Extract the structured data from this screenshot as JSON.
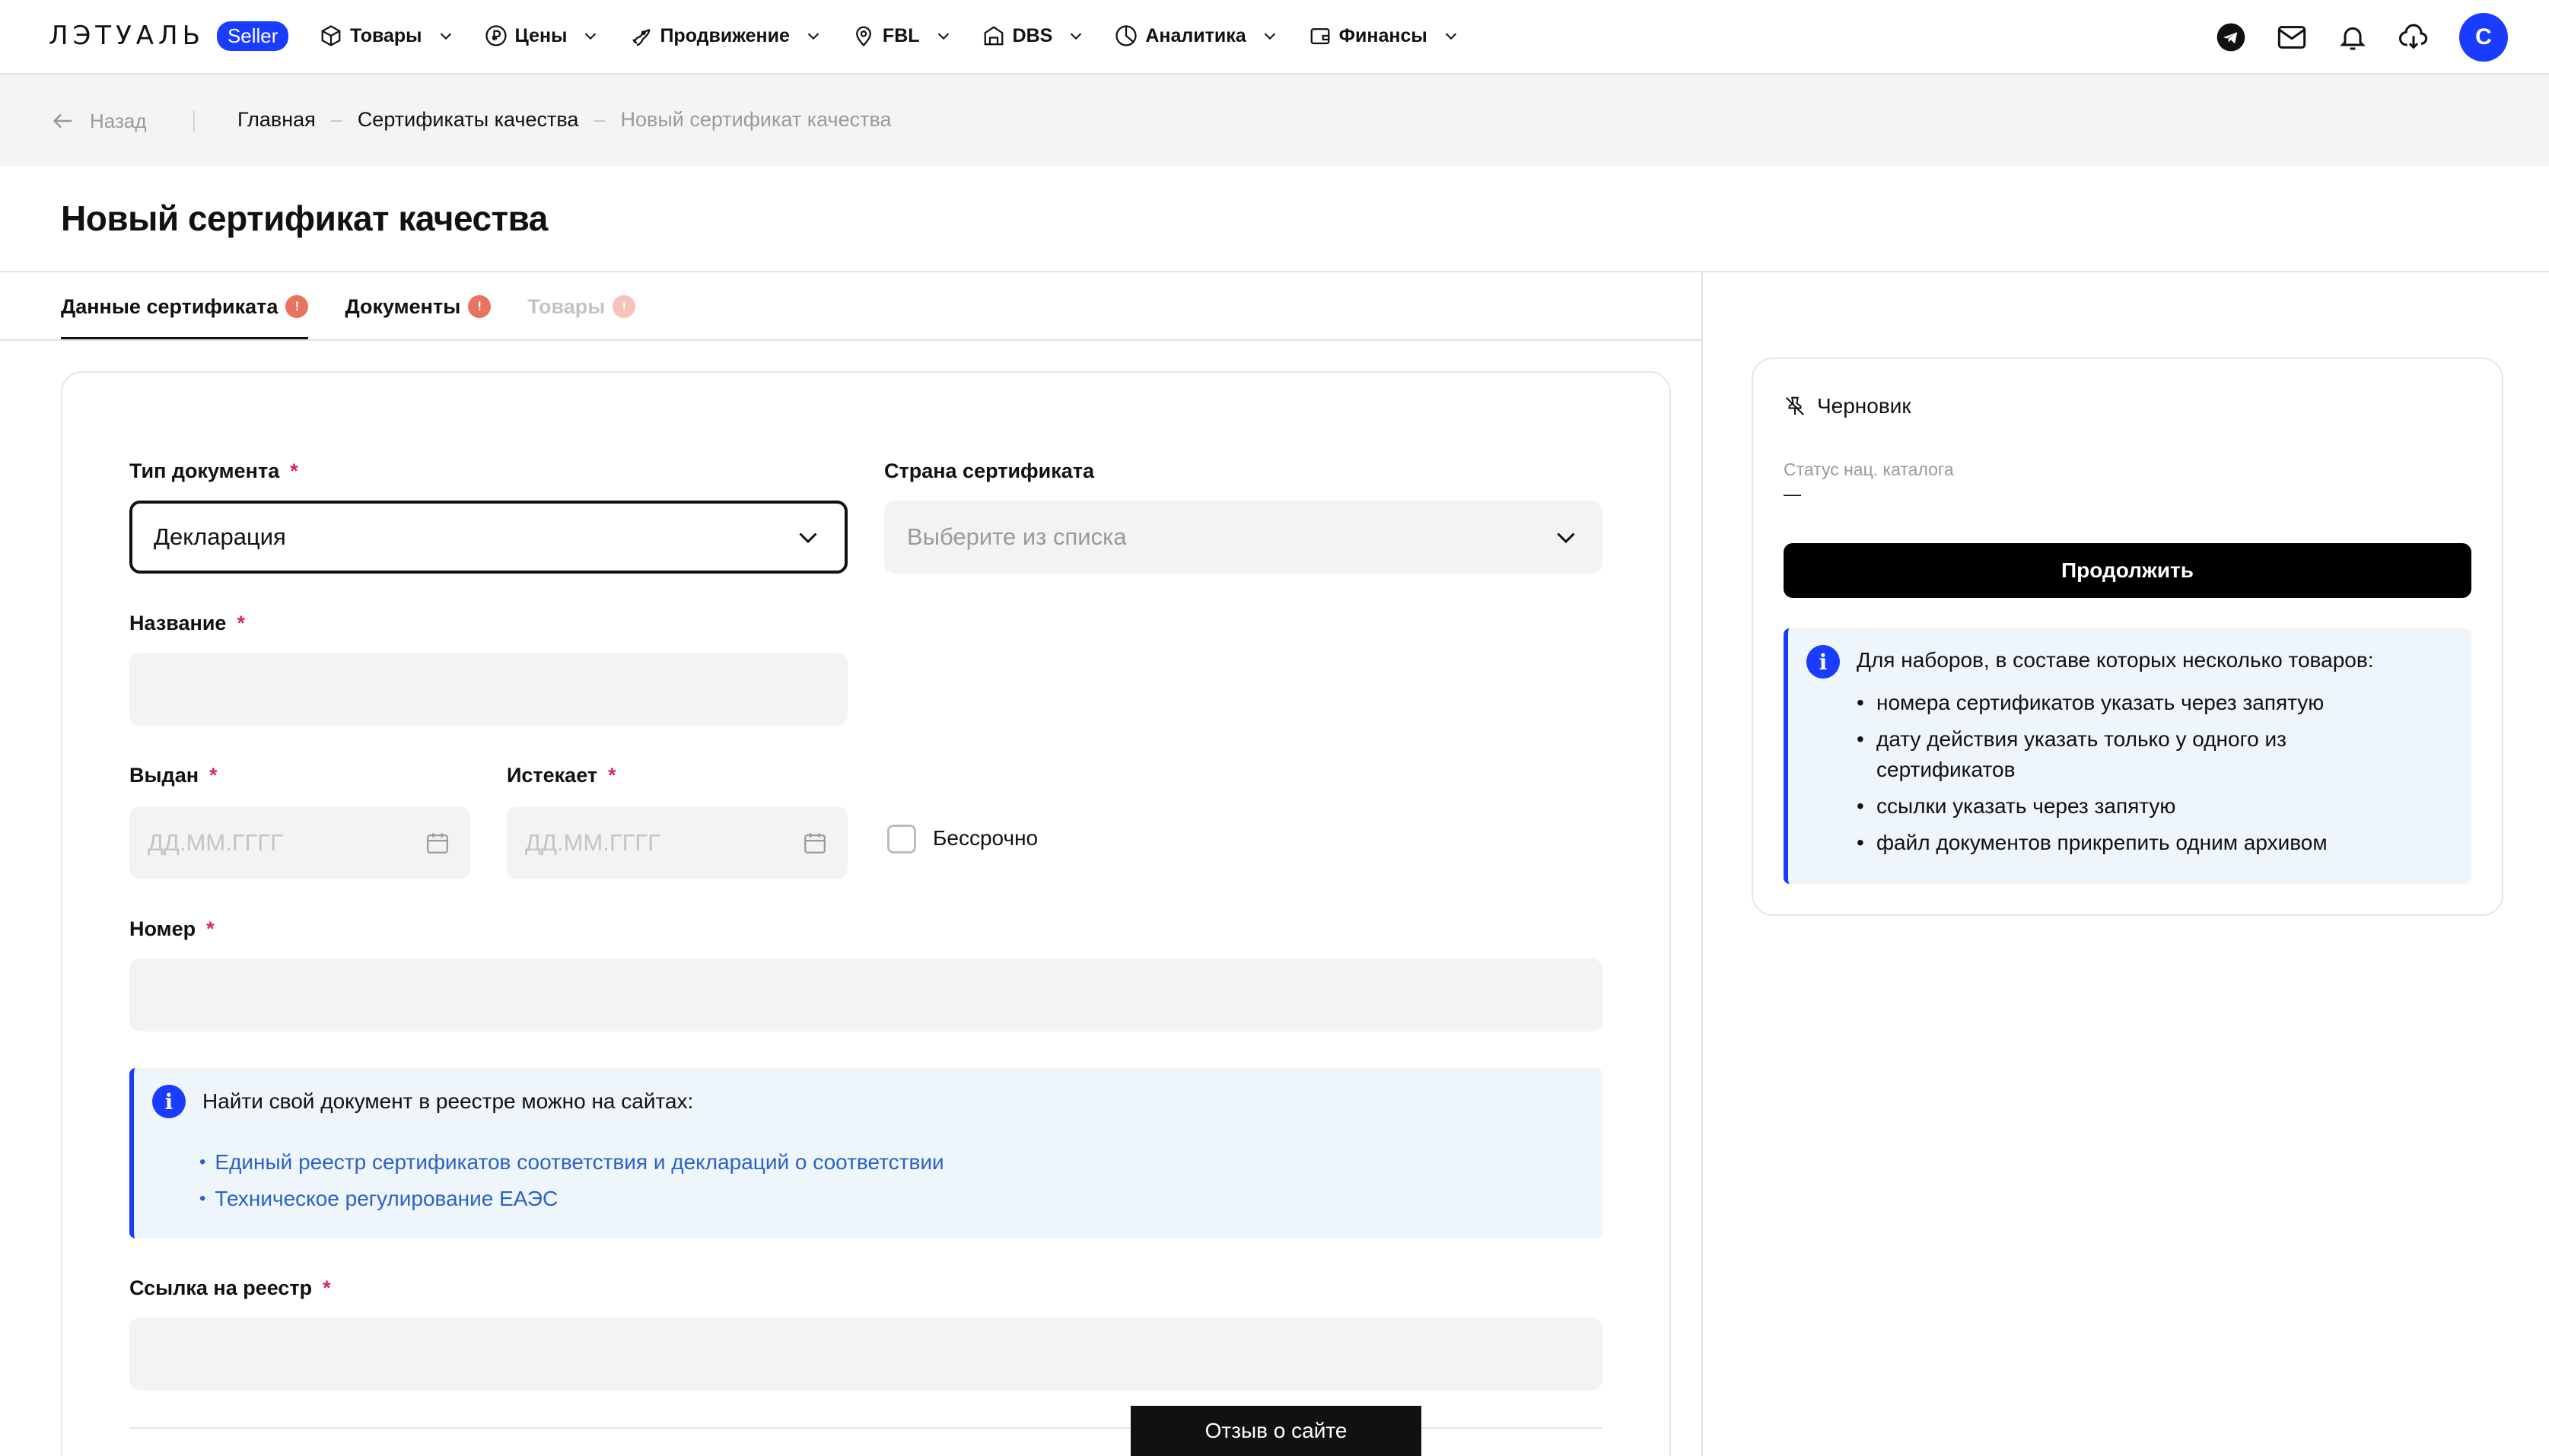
{
  "app": {
    "logo_text": "ЛЭТУАЛЬ",
    "logo_badge": "Seller",
    "brand_color": "#1a3cff"
  },
  "nav": {
    "items": [
      {
        "label": "Товары",
        "icon": "box-icon"
      },
      {
        "label": "Цены",
        "icon": "ruble-icon"
      },
      {
        "label": "Продвижение",
        "icon": "rocket-icon"
      },
      {
        "label": "FBL",
        "icon": "location-pin-icon"
      },
      {
        "label": "DBS",
        "icon": "warehouse-icon"
      },
      {
        "label": "Аналитика",
        "icon": "pie-chart-icon"
      },
      {
        "label": "Финансы",
        "icon": "wallet-icon"
      }
    ],
    "right_icons": [
      "telegram-icon",
      "mail-icon",
      "bell-icon",
      "download-icon"
    ],
    "avatar_letter": "С"
  },
  "breadcrumbs": {
    "back_label": "Назад",
    "items": [
      "Главная",
      "Сертификаты качества",
      "Новый сертификат качества"
    ]
  },
  "page": {
    "title": "Новый сертификат качества"
  },
  "tabs": [
    {
      "label": "Данные сертификата",
      "badge": "!",
      "state": "active"
    },
    {
      "label": "Документы",
      "badge": "!",
      "state": "normal"
    },
    {
      "label": "Товары",
      "badge": "!",
      "state": "disabled"
    }
  ],
  "form": {
    "doc_type": {
      "label": "Тип документа",
      "required": "*",
      "value": "Декларация"
    },
    "country": {
      "label": "Страна сертификата",
      "placeholder": "Выберите из списка"
    },
    "name": {
      "label": "Название",
      "required": "*",
      "value": ""
    },
    "issued": {
      "label": "Выдан",
      "required": "*",
      "placeholder": "ДД.ММ.ГГГГ"
    },
    "expires": {
      "label": "Истекает",
      "required": "*",
      "placeholder": "ДД.ММ.ГГГГ"
    },
    "indefinite": {
      "label": "Бессрочно",
      "checked": false
    },
    "number": {
      "label": "Номер",
      "required": "*",
      "value": ""
    },
    "registry_info": {
      "title": "Найти свой документ в реестре можно на сайтах:",
      "links": [
        "Единый реестр сертификатов соответствия и деклараций о соответствии",
        "Техническое регулирование ЕАЭС"
      ]
    },
    "registry_link": {
      "label": "Ссылка на реестр",
      "required": "*",
      "value": ""
    }
  },
  "feedback_button": "Отзыв о сайте",
  "sidebar": {
    "status_title": "Черновик",
    "catalog_status_label": "Статус нац. каталога",
    "catalog_status_value": "—",
    "continue_button": "Продолжить",
    "info": {
      "title": "Для наборов, в составе которых несколько товаров:",
      "bullets": [
        "номера сертификатов указать через запятую",
        "дату действия указать только у одного из сертификатов",
        "ссылки указать через запятую",
        "файл документов прикрепить одним архивом"
      ]
    }
  }
}
